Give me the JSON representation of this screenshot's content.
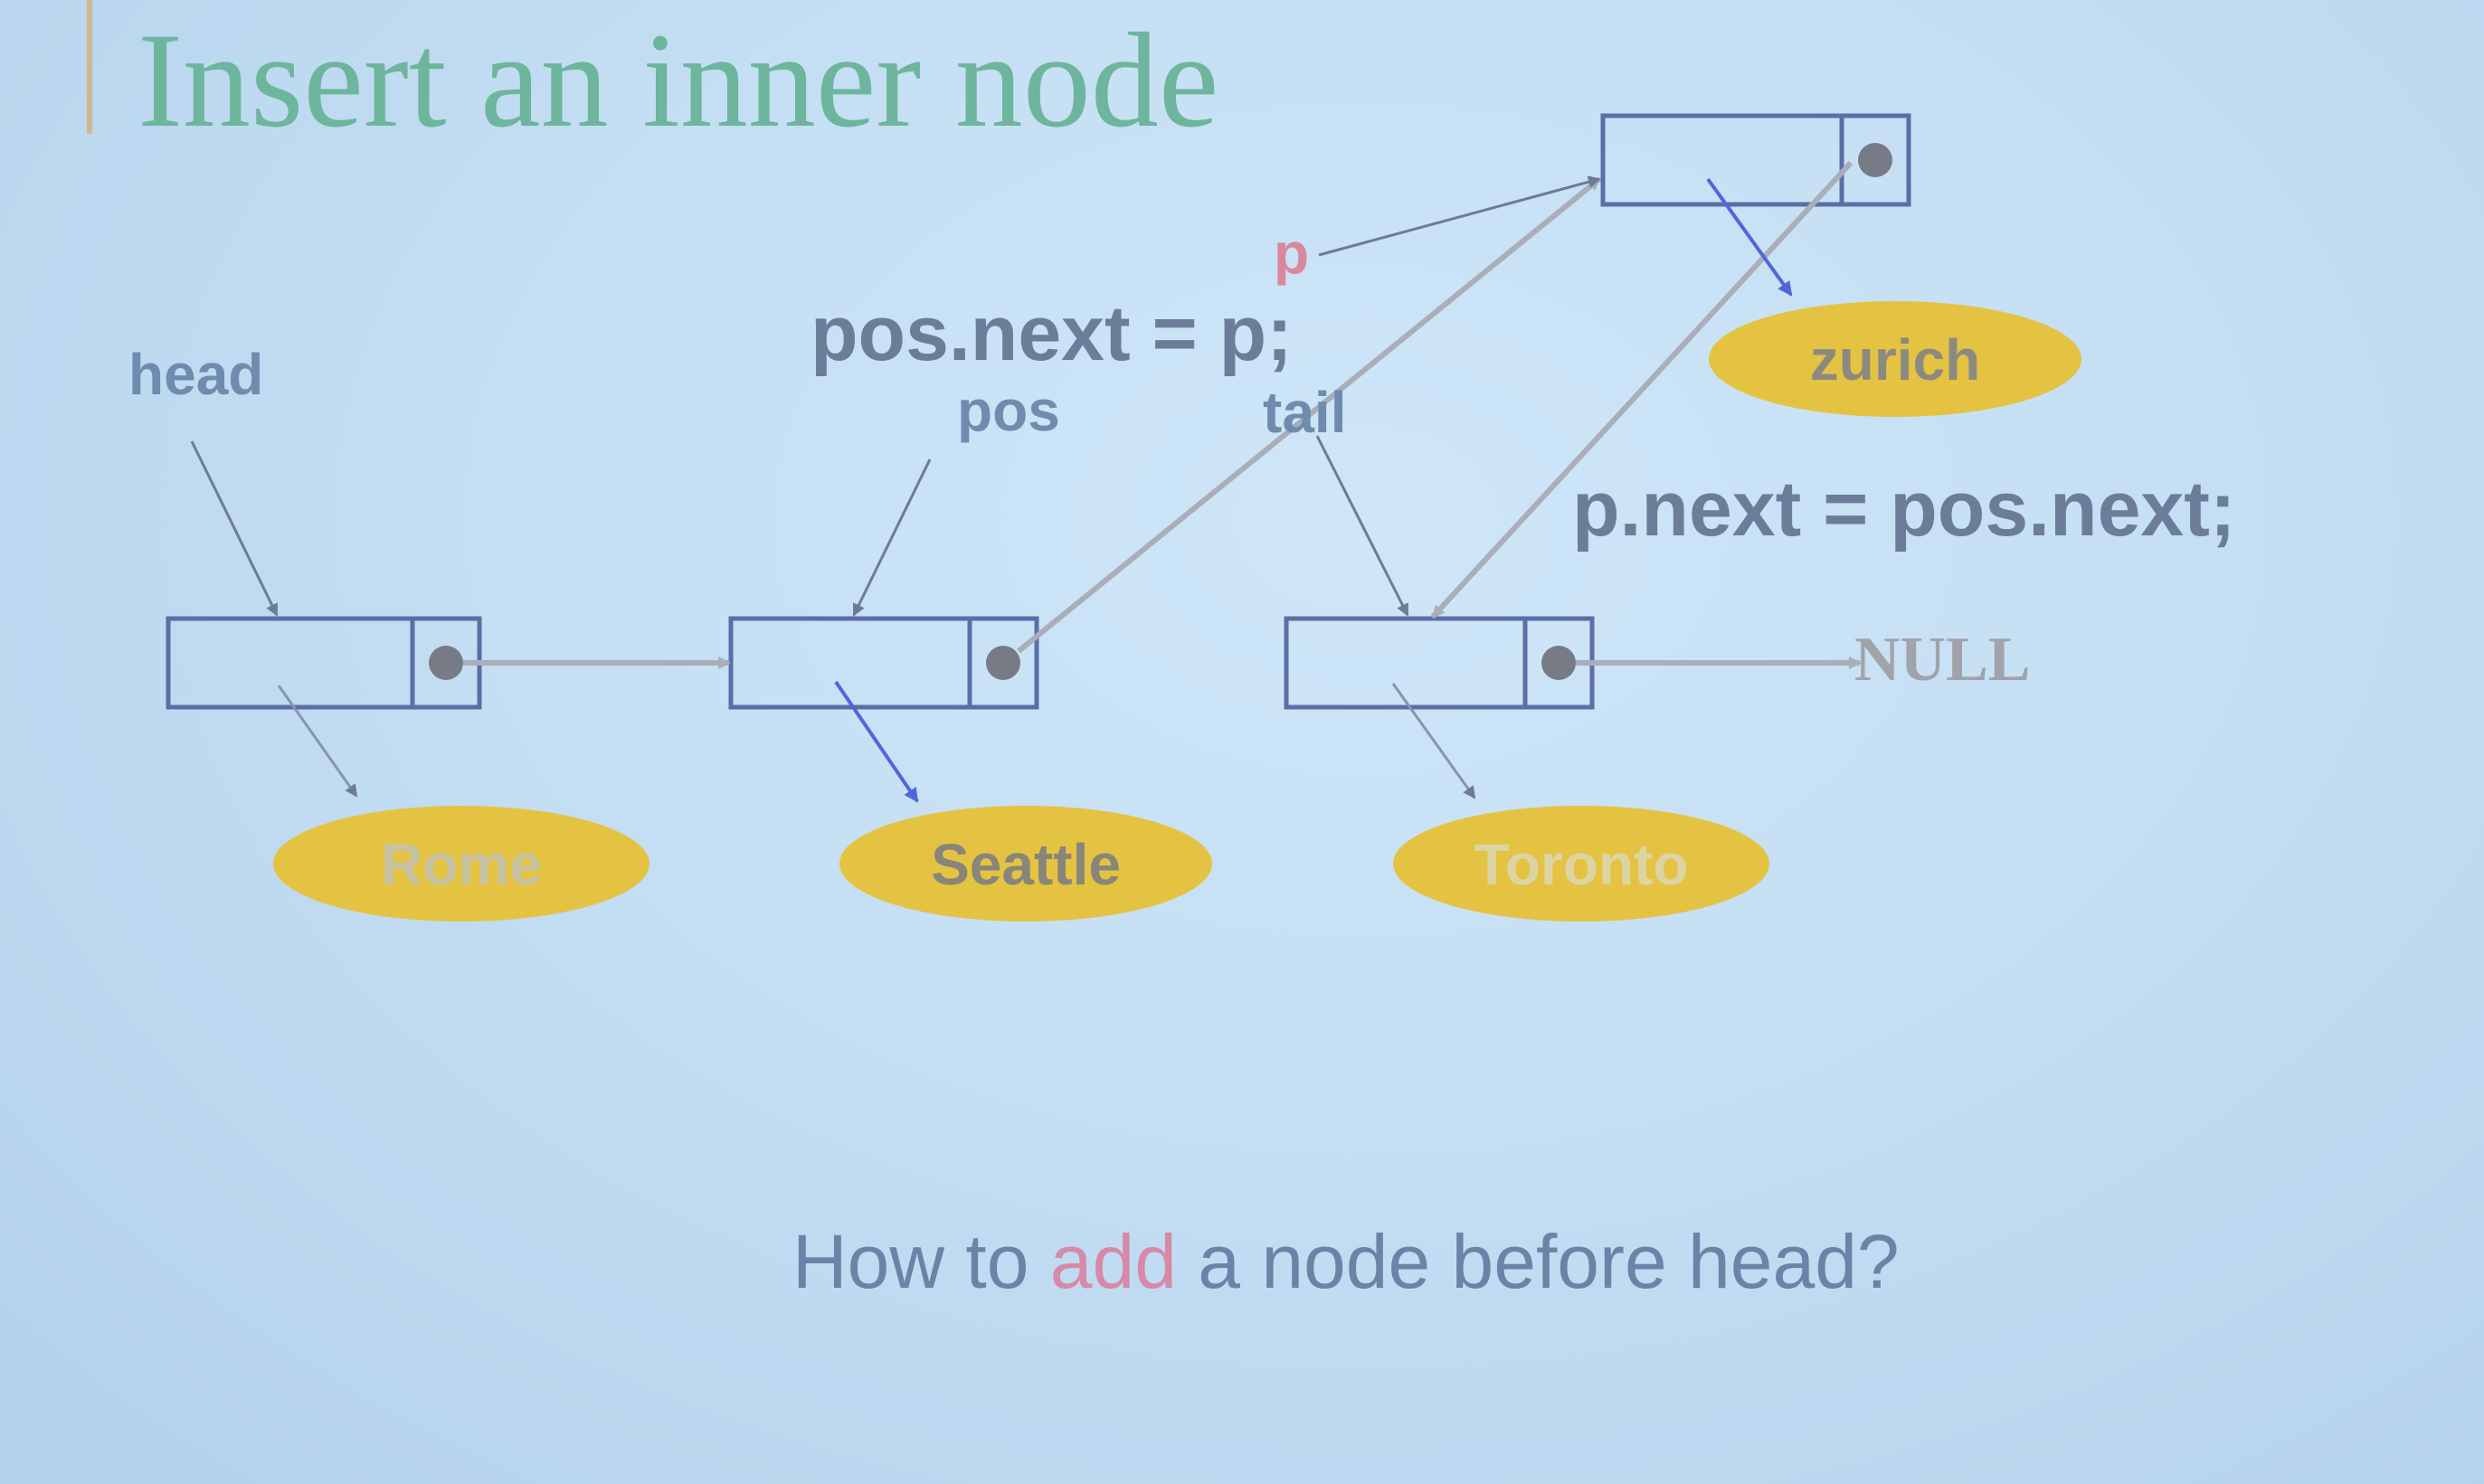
{
  "title": "Insert an inner node",
  "labels": {
    "head": "head",
    "pos": "pos",
    "tail": "tail",
    "p": "p"
  },
  "code": {
    "line1": "pos.next = p;",
    "line2": "p.next = pos.next;"
  },
  "nodes": [
    {
      "value": "Rome"
    },
    {
      "value": "Seattle"
    },
    {
      "value": "Toronto"
    },
    {
      "value": "zurich"
    }
  ],
  "null_label": "NULL",
  "question": {
    "before": "How to ",
    "highlight": "add",
    "after": " a node before head?"
  },
  "colors": {
    "node_border": "#5c6ea6",
    "pointer_dot": "#777b86",
    "arrow": "#a9aeb8",
    "blue_arrow": "#4f67d8",
    "value_fill": "#e4c343",
    "title": "#6db59c",
    "highlight": "#d58aa8"
  }
}
